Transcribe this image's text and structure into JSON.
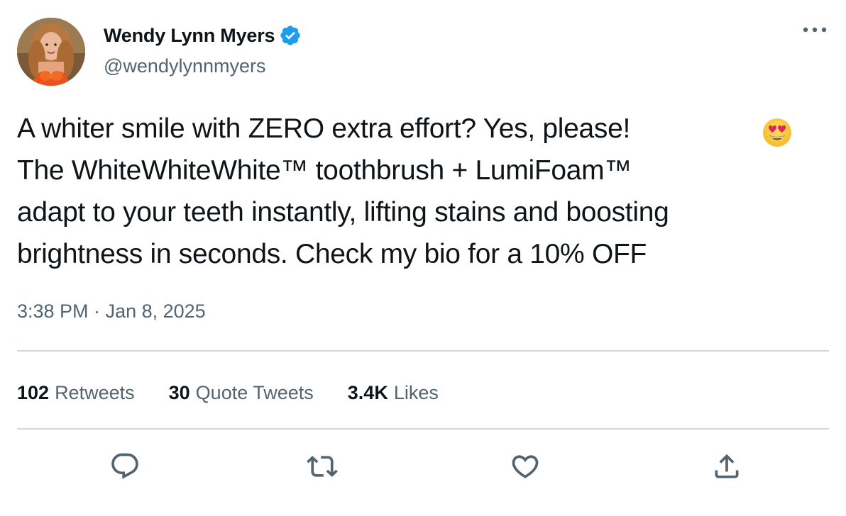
{
  "author": {
    "display_name": "Wendy Lynn Myers",
    "handle": "@wendylynnmyers",
    "verified": true
  },
  "tweet": {
    "text": "A whiter smile with ZERO extra effort? Yes, please! \nThe WhiteWhiteWhite™ toothbrush + LumiFoam™\nadapt to your teeth instantly, lifting stains and boosting\nbrightness in seconds. Check my bio for a 10% OFF",
    "emoji": "smiling-face-with-heart-eyes",
    "time": "3:38 PM",
    "separator": " · ",
    "date": "Jan 8, 2025"
  },
  "stats": {
    "retweets_count": "102",
    "retweets_label": "Retweets",
    "quotes_count": "30",
    "quotes_label": "Quote Tweets",
    "likes_count": "3.4K",
    "likes_label": "Likes"
  },
  "icons": {
    "more": "more-horizontal-icon",
    "reply": "reply-icon",
    "retweet": "retweet-icon",
    "like": "heart-icon",
    "share": "share-icon",
    "verified": "verified-badge-icon"
  },
  "colors": {
    "primary_text": "#0f1419",
    "secondary_text": "#536471",
    "divider": "#cfd9de",
    "verified_blue": "#1d9bf0"
  }
}
